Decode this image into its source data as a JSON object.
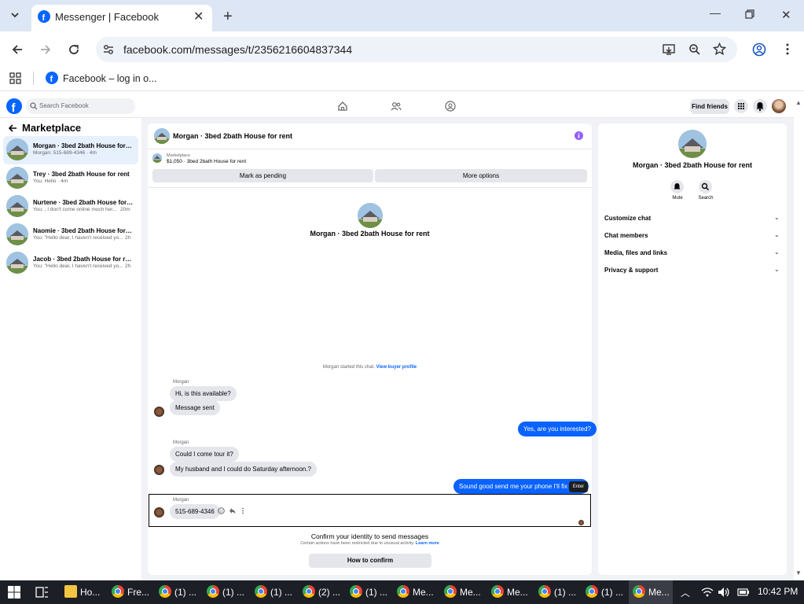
{
  "browser": {
    "tab_title": "Messenger | Facebook",
    "url": "facebook.com/messages/t/2356216604837344",
    "bookmark": "Facebook – log in o..."
  },
  "fb": {
    "search_placeholder": "Search Facebook",
    "find_friends": "Find friends"
  },
  "sidebar": {
    "title": "Marketplace",
    "items": [
      {
        "title": "Morgan · 3bed 2bath House for rent",
        "sub": "Morgan: 515-689-4346 · 4m",
        "time": ""
      },
      {
        "title": "Trey · 3bed 2bath House for rent",
        "sub": "You: Hello · 4m",
        "time": ""
      },
      {
        "title": "Nurtene · 3bed 2bath House for re...",
        "sub": "You: , I don't come online much her...",
        "time": "20m"
      },
      {
        "title": "Naomie · 3bed 2bath House for rent",
        "sub": "You: \"Hello dear, I haven't received yo...",
        "time": "2h"
      },
      {
        "title": "Jacob · 3bed 2bath House for rent",
        "sub": "You: \"Hello dear, I haven't received yo...",
        "time": "2h"
      }
    ]
  },
  "conversation": {
    "header_title": "Morgan · 3bed 2bath House for rent",
    "listing_label": "Marketplace",
    "listing_detail": "$1,050 · 3bed 2bath House for rent",
    "mark_pending": "Mark as pending",
    "more_options": "More options",
    "intro_title": "Morgan · 3bed 2bath House for rent",
    "started_text": "Morgan started this chat.",
    "view_profile": "View buyer profile",
    "messages": [
      {
        "sender": "Morgan",
        "text": "Hi, is this available?"
      },
      {
        "text": "Message sent"
      },
      {
        "text": "Yes, are you interested?"
      },
      {
        "sender": "Morgan",
        "text": "Could I come tour it?"
      },
      {
        "text": "My husband and I could do Saturday afternoon.?"
      },
      {
        "text": "Sound good send me your phone I'll fix th"
      },
      {
        "sender": "Morgan",
        "text": "515-689-4346"
      }
    ],
    "enter_tooltip": "Enter",
    "confirm_title": "Confirm your identity to send messages",
    "confirm_sub": "Certain actions have been restricted due to unusual activity.",
    "learn_more": "Learn more",
    "how_to_confirm": "How to confirm"
  },
  "details": {
    "title": "Morgan · 3bed 2bath House for rent",
    "mute": "Mute",
    "search": "Search",
    "sections": [
      "Customize chat",
      "Chat members",
      "Media, files and links",
      "Privacy & support"
    ]
  },
  "taskbar": {
    "apps": [
      "Ho...",
      "Fre...",
      "(1) ...",
      "(1) ...",
      "(1) ...",
      "(2) ...",
      "(1) ...",
      "Me...",
      "Me...",
      "Me...",
      "(1) ...",
      "(1) ...",
      "Me..."
    ],
    "time": "10:42 PM"
  },
  "colors": {
    "accent": "#0a62ff",
    "fb_blue": "#0866ff",
    "purple_info": "#9360f7"
  }
}
